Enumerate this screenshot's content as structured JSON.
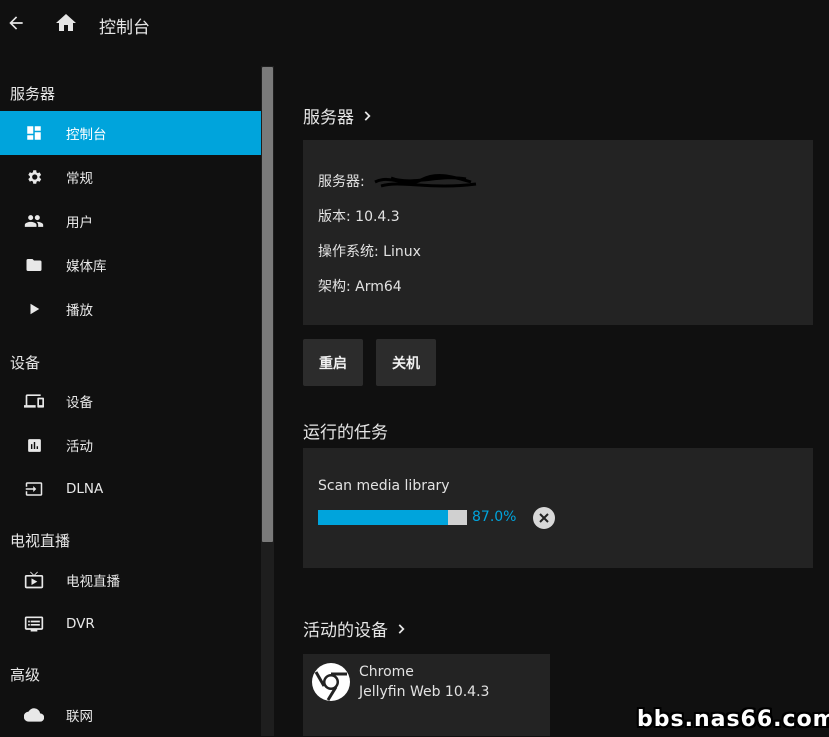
{
  "header": {
    "title": "控制台"
  },
  "sidebar": {
    "sections": [
      {
        "title": "服务器",
        "items": [
          {
            "label": "控制台",
            "icon": "dashboard-icon",
            "active": true
          },
          {
            "label": "常规",
            "icon": "settings-icon"
          },
          {
            "label": "用户",
            "icon": "people-icon"
          },
          {
            "label": "媒体库",
            "icon": "folder-icon"
          },
          {
            "label": "播放",
            "icon": "play-icon"
          }
        ]
      },
      {
        "title": "设备",
        "items": [
          {
            "label": "设备",
            "icon": "devices-icon"
          },
          {
            "label": "活动",
            "icon": "assessment-icon"
          },
          {
            "label": "DLNA",
            "icon": "input-icon"
          }
        ]
      },
      {
        "title": "电视直播",
        "items": [
          {
            "label": "电视直播",
            "icon": "live-tv-icon"
          },
          {
            "label": "DVR",
            "icon": "dvr-icon"
          }
        ]
      },
      {
        "title": "高级",
        "items": [
          {
            "label": "联网",
            "icon": "cloud-icon"
          }
        ]
      }
    ]
  },
  "server": {
    "section_title": "服务器",
    "name_label": "服务器:",
    "version": "版本: 10.4.3",
    "os": "操作系统: Linux",
    "arch": "架构: Arm64",
    "restart_button": "重启",
    "shutdown_button": "关机"
  },
  "tasks": {
    "section_title": "运行的任务",
    "task_name": "Scan media library",
    "progress_text": "87.0%",
    "progress": 0.87
  },
  "devices": {
    "section_title": "活动的设备",
    "device_name": "Chrome",
    "device_app": "Jellyfin Web 10.4.3"
  },
  "watermark": "bbs.nas66.com",
  "colors": {
    "accent": "#00a4dc",
    "background": "#101010",
    "card": "#232323"
  }
}
